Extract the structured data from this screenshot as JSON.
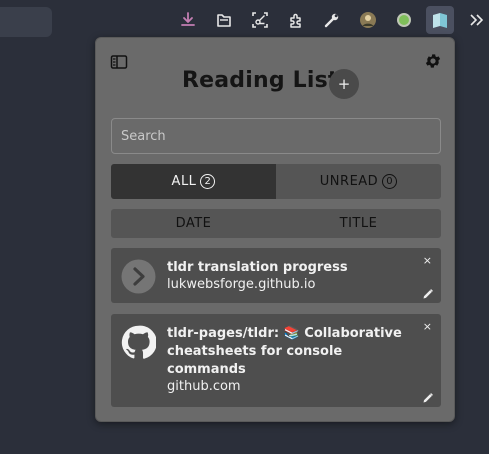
{
  "popup": {
    "title": "Reading List",
    "add_label": "+",
    "search": {
      "placeholder": "Search",
      "value": ""
    },
    "filters": [
      {
        "label": "ALL",
        "count": "2",
        "active": true
      },
      {
        "label": "UNREAD",
        "count": "0",
        "active": false
      }
    ],
    "sort": {
      "date_label": "DATE",
      "title_label": "TITLE"
    },
    "items": [
      {
        "title": "tldr translation progress",
        "domain": "lukwebsforge.github.io",
        "icon": "chevron-right-icon"
      },
      {
        "title": "tldr-pages/tldr: 📚 Collaborative cheatsheets for console commands",
        "domain": "github.com",
        "icon": "github-icon"
      }
    ],
    "close_label": "×"
  },
  "toolbar": {
    "icons": [
      "downloads-icon",
      "files-icon",
      "screenshot-icon",
      "extensions-icon",
      "tools-icon",
      "profile-avatar-icon",
      "status-dot-icon",
      "reading-list-icon",
      "overflow-icon"
    ],
    "accent_color": "#b45a9c"
  }
}
